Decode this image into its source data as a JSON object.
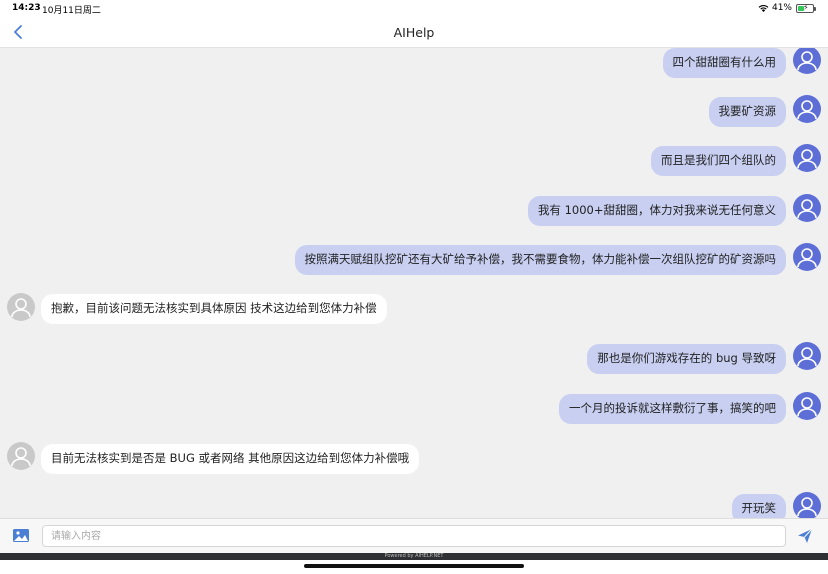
{
  "status_bar": {
    "time": "14:23",
    "date": "10月11日周二",
    "battery": "41%"
  },
  "nav": {
    "title": "AIHelp"
  },
  "messages": [
    {
      "sender": "user",
      "text": "四个甜甜圈有什么用"
    },
    {
      "sender": "user",
      "text": "我要矿资源"
    },
    {
      "sender": "user",
      "text": "而且是我们四个组队的"
    },
    {
      "sender": "user",
      "text": "我有 1000+甜甜圈，体力对我来说无任何意义"
    },
    {
      "sender": "user",
      "text": "按照满天赋组队挖矿还有大矿给予补偿，我不需要食物，体力能补偿一次组队挖矿的矿资源吗"
    },
    {
      "sender": "bot",
      "text": "抱歉，目前该问题无法核实到具体原因 技术这边给到您体力补偿"
    },
    {
      "sender": "user",
      "text": "那也是你们游戏存在的 bug 导致呀"
    },
    {
      "sender": "user",
      "text": "一个月的投诉就这样敷衍了事，搞笑的吧"
    },
    {
      "sender": "bot",
      "text": "目前无法核实到是否是 BUG 或者网络 其他原因这边给到您体力补偿哦"
    },
    {
      "sender": "user",
      "text": "开玩笑"
    }
  ],
  "input": {
    "placeholder": "请输入内容",
    "value": ""
  },
  "footer": {
    "powered_by": "Powered by AIHELP.NET"
  },
  "colors": {
    "user_bubble": "#c8cff1",
    "user_avatar": "#5d6fd6",
    "bot_bubble": "#ffffff",
    "bot_avatar": "#c9c9c9",
    "chat_background": "#f0f0f0",
    "accent": "#4a7fd4"
  },
  "icons": {
    "back": "chevron-left-icon",
    "image": "image-icon",
    "send": "send-icon",
    "wifi": "wifi-icon",
    "battery": "battery-charging-icon"
  }
}
